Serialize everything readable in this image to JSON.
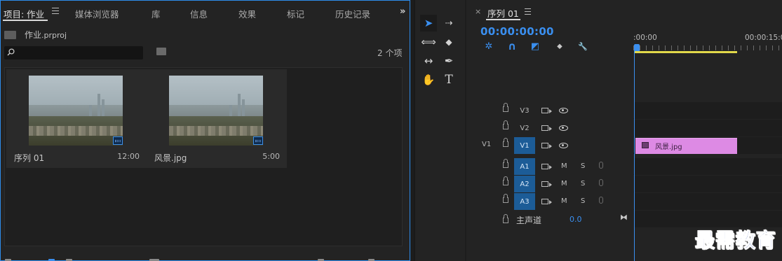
{
  "project_panel": {
    "tabs": [
      {
        "label": "项目: 作业",
        "active": true
      },
      {
        "label": "媒体浏览器",
        "active": false
      },
      {
        "label": "库",
        "active": false
      },
      {
        "label": "信息",
        "active": false
      },
      {
        "label": "效果",
        "active": false
      },
      {
        "label": "标记",
        "active": false
      },
      {
        "label": "历史记录",
        "active": false
      }
    ],
    "more_icon": "»",
    "project_name": "作业",
    "project_ext": ".prproj",
    "search_placeholder": "",
    "item_count": "2 个项",
    "items": [
      {
        "name": "序列 01",
        "duration": "12:00",
        "badge": "sequence-icon"
      },
      {
        "name": "风景.jpg",
        "duration": "5:00",
        "badge": "still-image-icon"
      }
    ]
  },
  "tools": [
    {
      "name": "selection-tool",
      "glyph": "➤",
      "active": true
    },
    {
      "name": "track-select-forward-tool",
      "glyph": "⇢"
    },
    {
      "name": "ripple-edit-tool",
      "glyph": "⟺"
    },
    {
      "name": "razor-tool",
      "glyph": "◆"
    },
    {
      "name": "slip-tool",
      "glyph": "↔"
    },
    {
      "name": "pen-tool",
      "glyph": "✒"
    },
    {
      "name": "hand-tool",
      "glyph": "✋"
    },
    {
      "name": "type-tool",
      "glyph": "T"
    }
  ],
  "timeline": {
    "tab_label": "序列 01",
    "close_glyph": "×",
    "timecode": "00:00:00:00",
    "ruler_labels": [
      ":00:00",
      "00:00:15:00"
    ],
    "tools": [
      {
        "name": "nest-toggle-icon",
        "glyph": "✲"
      },
      {
        "name": "snap-icon",
        "glyph": "∩"
      },
      {
        "name": "linked-selection-icon",
        "glyph": "◩"
      },
      {
        "name": "add-marker-icon",
        "glyph": "⬥"
      },
      {
        "name": "wrench-icon",
        "glyph": "🔧"
      }
    ],
    "video_tracks": [
      {
        "label": "V3",
        "source": "",
        "targeted": false
      },
      {
        "label": "V2",
        "source": "",
        "targeted": false
      },
      {
        "label": "V1",
        "source": "V1",
        "targeted": true
      }
    ],
    "audio_tracks": [
      {
        "label": "A1",
        "mute": "M",
        "solo": "S"
      },
      {
        "label": "A2",
        "mute": "M",
        "solo": "S"
      },
      {
        "label": "A3",
        "mute": "M",
        "solo": "S"
      }
    ],
    "clip": {
      "name": "风景.jpg",
      "color": "#dd8ae4"
    },
    "master": {
      "label": "主声道",
      "value": "0.0"
    }
  },
  "watermark": "最需教育",
  "colors": {
    "accent": "#3a8ff0",
    "track_target": "#1c5c97",
    "work_area": "#e1d84a"
  }
}
